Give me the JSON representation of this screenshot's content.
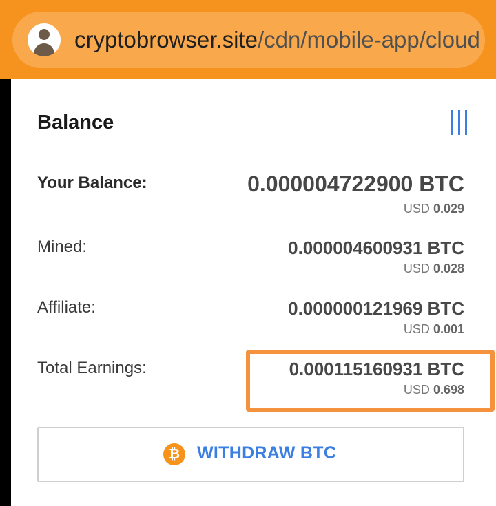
{
  "browser": {
    "url_host": "cryptobrowser.site",
    "url_path": "/cdn/mobile-app/cloud"
  },
  "card": {
    "title": "Balance",
    "menu_icon": "vertical-bars-icon"
  },
  "rows": [
    {
      "label": "Your Balance:",
      "btc": "0.000004722900 BTC",
      "usd_prefix": "USD",
      "usd_value": "0.029"
    },
    {
      "label": "Mined:",
      "btc": "0.000004600931 BTC",
      "usd_prefix": "USD",
      "usd_value": "0.028"
    },
    {
      "label": "Affiliate:",
      "btc": "0.000000121969 BTC",
      "usd_prefix": "USD",
      "usd_value": "0.001"
    },
    {
      "label": "Total Earnings:",
      "btc": "0.000115160931 BTC",
      "usd_prefix": "USD",
      "usd_value": "0.698"
    }
  ],
  "withdraw": {
    "label": "WITHDRAW BTC",
    "icon_glyph": "₿",
    "icon": "bitcoin-icon"
  },
  "colors": {
    "brand_orange": "#f6931e",
    "accent_blue": "#3b7fe2",
    "highlight_orange": "#f5923e",
    "bitcoin_orange": "#f7931a"
  }
}
